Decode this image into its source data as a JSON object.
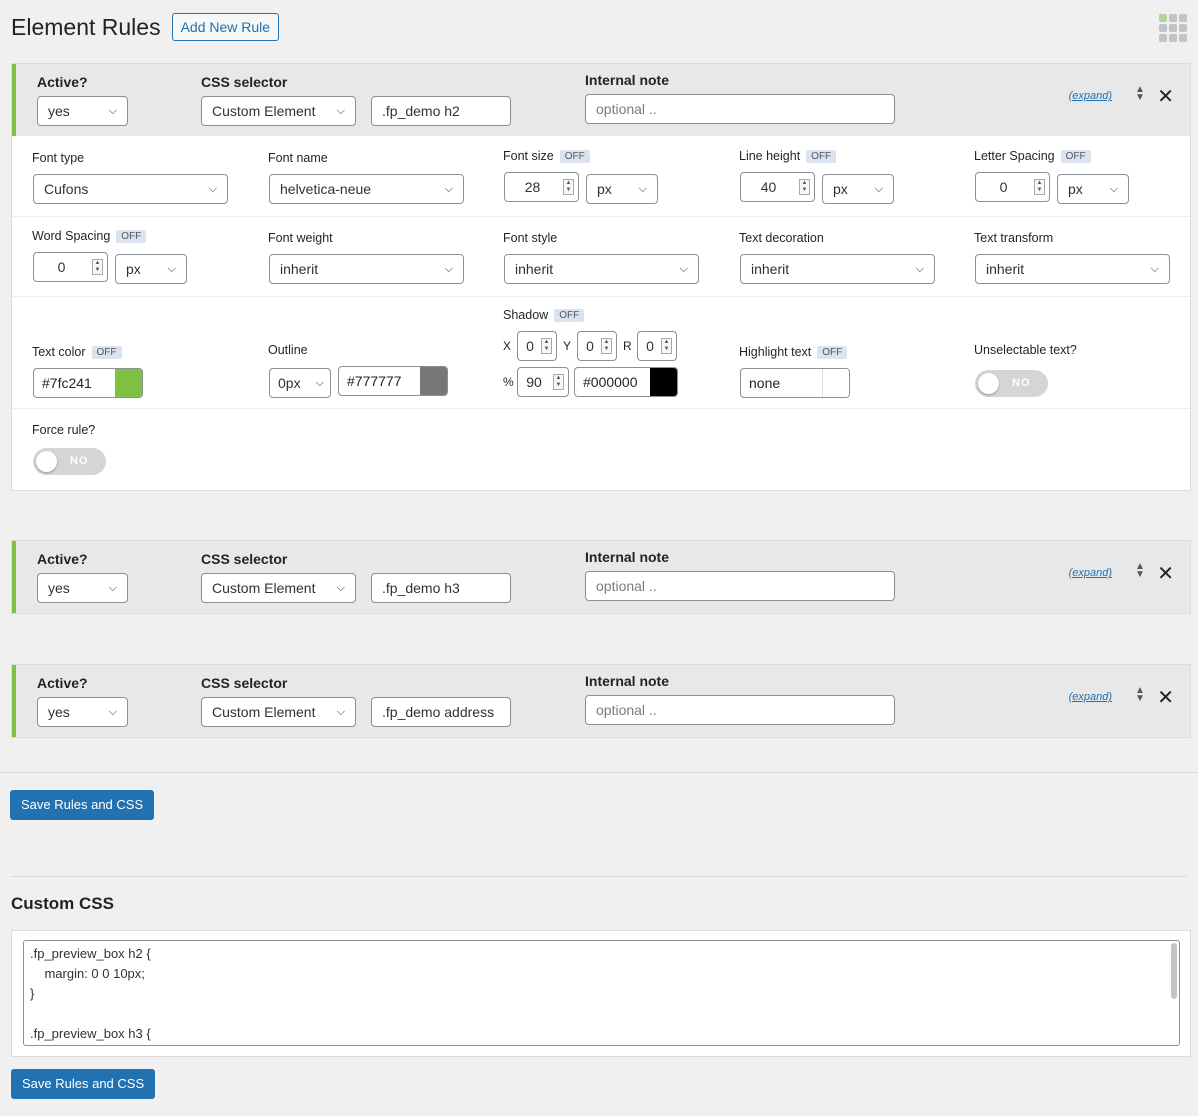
{
  "page": {
    "title": "Element Rules",
    "add_rule_label": "Add New Rule"
  },
  "labels": {
    "active": "Active?",
    "css_selector": "CSS selector",
    "internal_note": "Internal note",
    "expand": "(expand)",
    "off": "OFF",
    "font_type": "Font type",
    "font_name": "Font name",
    "font_size": "Font size",
    "line_height": "Line height",
    "letter_spacing": "Letter Spacing",
    "word_spacing": "Word Spacing",
    "font_weight": "Font weight",
    "font_style": "Font style",
    "text_decoration": "Text decoration",
    "text_transform": "Text transform",
    "shadow": "Shadow",
    "text_color": "Text color",
    "outline": "Outline",
    "highlight_text": "Highlight text",
    "unselectable_text": "Unselectable text?",
    "force_rule": "Force rule?",
    "toggle_no": "NO",
    "shadow_x": "X",
    "shadow_y": "Y",
    "shadow_r": "R",
    "shadow_pct": "%"
  },
  "rules": [
    {
      "active": "yes",
      "selector_type": "Custom Element",
      "selector": ".fp_demo h2",
      "note_placeholder": "optional .."
    },
    {
      "active": "yes",
      "selector_type": "Custom Element",
      "selector": ".fp_demo h3",
      "note_placeholder": "optional .."
    },
    {
      "active": "yes",
      "selector_type": "Custom Element",
      "selector": ".fp_demo address",
      "note_placeholder": "optional .."
    }
  ],
  "details": {
    "font_type": "Cufons",
    "font_name": "helvetica-neue",
    "font_size": "28",
    "font_size_unit": "px",
    "line_height": "40",
    "line_height_unit": "px",
    "letter_spacing": "0",
    "letter_spacing_unit": "px",
    "word_spacing": "0",
    "word_spacing_unit": "px",
    "font_weight": "inherit",
    "font_style": "inherit",
    "text_decoration": "inherit",
    "text_transform": "inherit",
    "text_color": "#7fc241",
    "outline_size": "0px",
    "outline_color": "#777777",
    "shadow_x": "0",
    "shadow_y": "0",
    "shadow_r": "0",
    "shadow_opacity": "90",
    "shadow_color": "#000000",
    "highlight": "none"
  },
  "colors": {
    "accent": "#7fc241",
    "outline_swatch": "#777777",
    "shadow_swatch": "#000000",
    "highlight_swatch": "#ffffff",
    "primary": "#2271b1"
  },
  "save_label": "Save Rules and CSS",
  "custom_css": {
    "title": "Custom CSS",
    "content": ".fp_preview_box h2 {\n    margin: 0 0 10px;\n}\n\n.fp_preview_box h3 {"
  }
}
